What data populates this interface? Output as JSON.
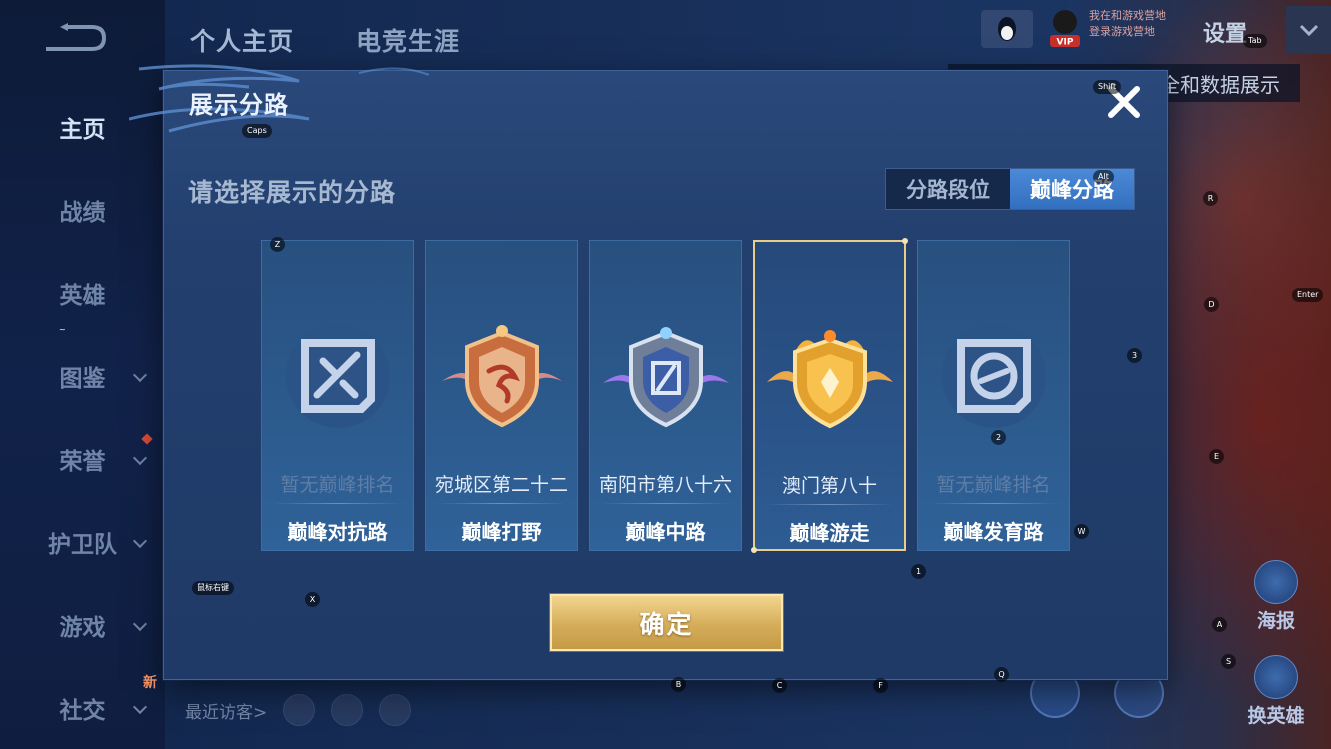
{
  "app": {
    "top_tabs": [
      "个人主页",
      "电竞生涯"
    ],
    "sidebar": [
      {
        "label": "主页",
        "active": true,
        "chevron": false
      },
      {
        "label": "战绩",
        "active": false,
        "chevron": false
      },
      {
        "label": "英雄",
        "active": false,
        "chevron": false
      },
      {
        "label": "图鉴",
        "active": false,
        "chevron": true
      },
      {
        "label": "荣誉",
        "active": false,
        "chevron": true,
        "dot": true
      },
      {
        "label": "护卫队",
        "active": false,
        "chevron": true
      },
      {
        "label": "游戏",
        "active": false,
        "chevron": true
      },
      {
        "label": "社交",
        "active": false,
        "chevron": true,
        "badge": "新"
      }
    ],
    "top_right": {
      "vip_label": "VIP",
      "vip_line1": "我在和游戏营地",
      "vip_line2": "登录游戏营地",
      "settings_label": "设置",
      "data_strip": "全和数据展示"
    },
    "bottom": {
      "recent_visitors": "最近访客>"
    },
    "right_buttons": [
      {
        "label": "海报",
        "icon": "poster-icon"
      },
      {
        "label": "换英雄",
        "icon": "swap-hero-icon"
      }
    ]
  },
  "modal": {
    "title": "展示分路",
    "prompt": "请选择展示的分路",
    "segment": {
      "options": [
        "分路段位",
        "巅峰分路"
      ],
      "selected": 1
    },
    "cards": [
      {
        "rank": "暂无巅峰排名",
        "lane": "巅峰对抗路",
        "emblem": "clash-lane-icon",
        "ranked": false
      },
      {
        "rank": "宛城区第二十二",
        "lane": "巅峰打野",
        "emblem": "jungle-badge-icon",
        "ranked": true
      },
      {
        "rank": "南阳市第八十六",
        "lane": "巅峰中路",
        "emblem": "mid-lane-badge-icon",
        "ranked": true
      },
      {
        "rank": "澳门第八十",
        "lane": "巅峰游走",
        "emblem": "roam-badge-icon",
        "ranked": true,
        "selected": true
      },
      {
        "rank": "暂无巅峰排名",
        "lane": "巅峰发育路",
        "emblem": "farm-lane-icon",
        "ranked": false
      }
    ],
    "confirm_label": "确定"
  },
  "key_hints": {
    "tab": "Tab",
    "shift": "Shift",
    "caps": "Caps",
    "alt": "Alt",
    "enter": "Enter",
    "mouse_right": "鼠标右键",
    "z": "Z",
    "r": "R",
    "d": "D",
    "three": "3",
    "e": "E",
    "two": "2",
    "w": "W",
    "one": "1",
    "x": "X",
    "a": "A",
    "s": "S",
    "b": "B",
    "c": "C",
    "f": "F",
    "q": "Q",
    "tilde": "~"
  }
}
